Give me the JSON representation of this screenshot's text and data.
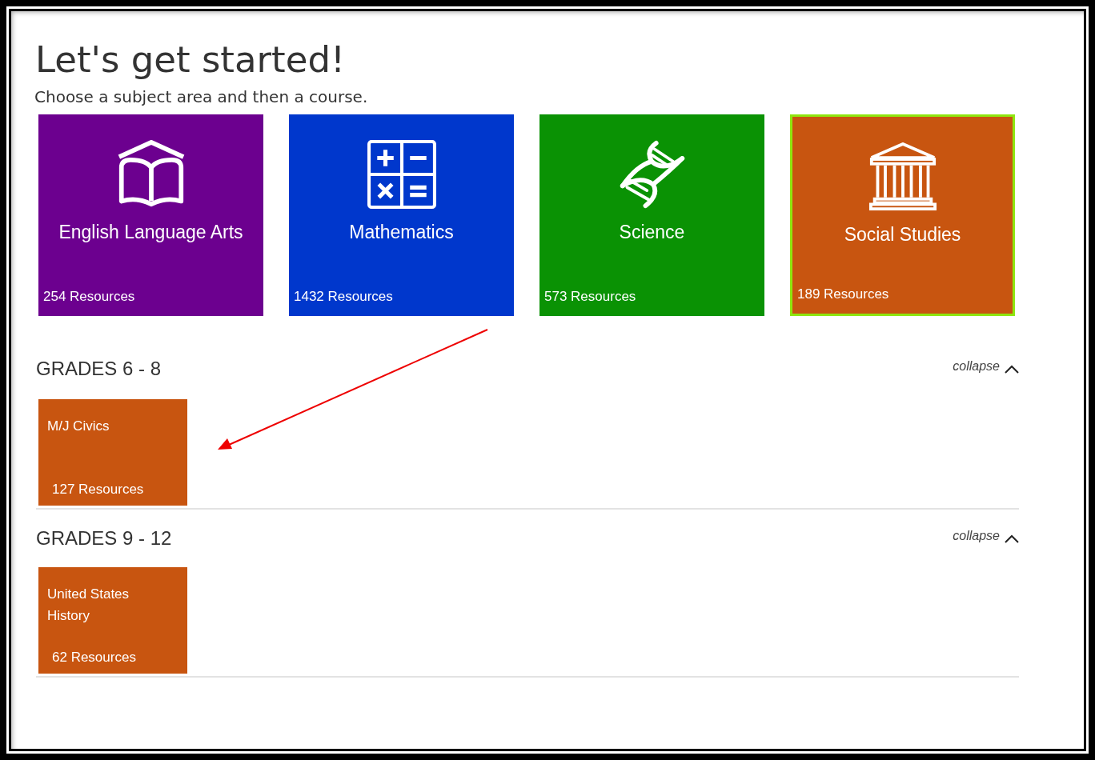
{
  "heading": "Let's get started!",
  "subtitle": "Choose a subject area and then a course.",
  "subjects": [
    {
      "name": "English Language Arts",
      "resources": "254 Resources",
      "kind": "book",
      "color": "#6c008f",
      "selected": false
    },
    {
      "name": "Mathematics",
      "resources": "1432 Resources",
      "kind": "calculator",
      "color": "#0037cc",
      "selected": false
    },
    {
      "name": "Science",
      "resources": "573 Resources",
      "kind": "dna",
      "color": "#0a9204",
      "selected": false
    },
    {
      "name": "Social Studies",
      "resources": "189 Resources",
      "kind": "building",
      "color": "#c85510",
      "selected": true
    }
  ],
  "grade_groups": [
    {
      "title": "GRADES 6 - 8",
      "toggle": "collapse",
      "courses": [
        {
          "name": "M/J Civics",
          "resources": "127 Resources"
        }
      ]
    },
    {
      "title": "GRADES 9 - 12",
      "toggle": "collapse",
      "courses": [
        {
          "name": "United States History",
          "resources": "62 Resources"
        }
      ]
    }
  ]
}
